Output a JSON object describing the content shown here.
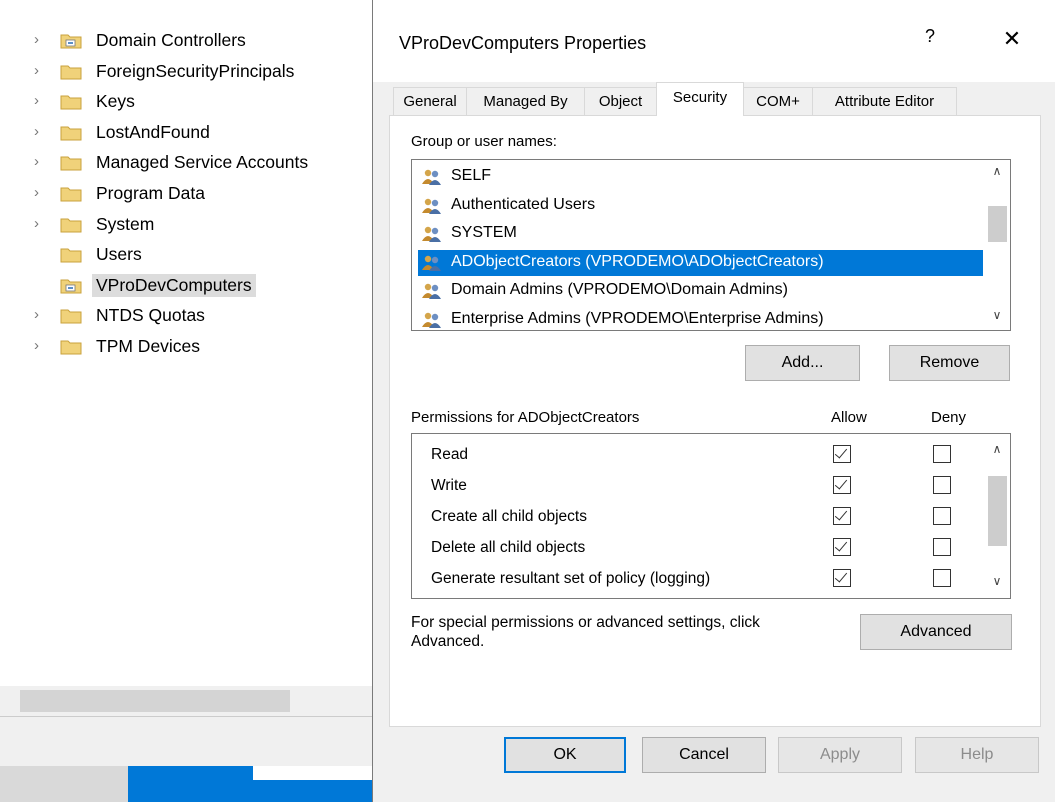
{
  "tree": {
    "items": [
      {
        "label": "Domain Controllers",
        "expandable": true,
        "selected": false
      },
      {
        "label": "ForeignSecurityPrincipals",
        "expandable": true,
        "selected": false
      },
      {
        "label": "Keys",
        "expandable": true,
        "selected": false
      },
      {
        "label": "LostAndFound",
        "expandable": true,
        "selected": false
      },
      {
        "label": "Managed Service Accounts",
        "expandable": true,
        "selected": false
      },
      {
        "label": "Program Data",
        "expandable": true,
        "selected": false
      },
      {
        "label": "System",
        "expandable": true,
        "selected": false
      },
      {
        "label": "Users",
        "expandable": false,
        "selected": false
      },
      {
        "label": "VProDevComputers",
        "expandable": false,
        "selected": true
      },
      {
        "label": "NTDS Quotas",
        "expandable": true,
        "selected": false
      },
      {
        "label": "TPM Devices",
        "expandable": true,
        "selected": false
      }
    ]
  },
  "dialog": {
    "title": "VProDevComputers Properties",
    "help_label": "?",
    "close_label": "✕",
    "tabs": [
      {
        "label": "General",
        "active": false
      },
      {
        "label": "Managed By",
        "active": false
      },
      {
        "label": "Object",
        "active": false
      },
      {
        "label": "Security",
        "active": true
      },
      {
        "label": "COM+",
        "active": false
      },
      {
        "label": "Attribute Editor",
        "active": false
      }
    ],
    "group_label": "Group or user names:",
    "groups": [
      {
        "name": "SELF",
        "selected": false
      },
      {
        "name": "Authenticated Users",
        "selected": false
      },
      {
        "name": "SYSTEM",
        "selected": false
      },
      {
        "name": "ADObjectCreators (VPRODEMO\\ADObjectCreators)",
        "selected": true
      },
      {
        "name": "Domain Admins (VPRODEMO\\Domain Admins)",
        "selected": false
      },
      {
        "name": "Enterprise Admins (VPRODEMO\\Enterprise Admins)",
        "selected": false
      }
    ],
    "add_label": "Add...",
    "remove_label": "Remove",
    "permissions_label": "Permissions for ADObjectCreators",
    "allow_header": "Allow",
    "deny_header": "Deny",
    "permissions": [
      {
        "name": "Read",
        "allow": true,
        "deny": false
      },
      {
        "name": "Write",
        "allow": true,
        "deny": false
      },
      {
        "name": "Create all child objects",
        "allow": true,
        "deny": false
      },
      {
        "name": "Delete all child objects",
        "allow": true,
        "deny": false
      },
      {
        "name": "Generate resultant set of policy (logging)",
        "allow": true,
        "deny": false
      }
    ],
    "advanced_note": "For special permissions or advanced settings, click Advanced.",
    "advanced_label": "Advanced",
    "ok_label": "OK",
    "cancel_label": "Cancel",
    "apply_label": "Apply",
    "help_button_label": "Help"
  },
  "colors": {
    "selection": "#0078d7",
    "dialog_bg": "#f0f0f0",
    "folder": "#f0d27a"
  }
}
